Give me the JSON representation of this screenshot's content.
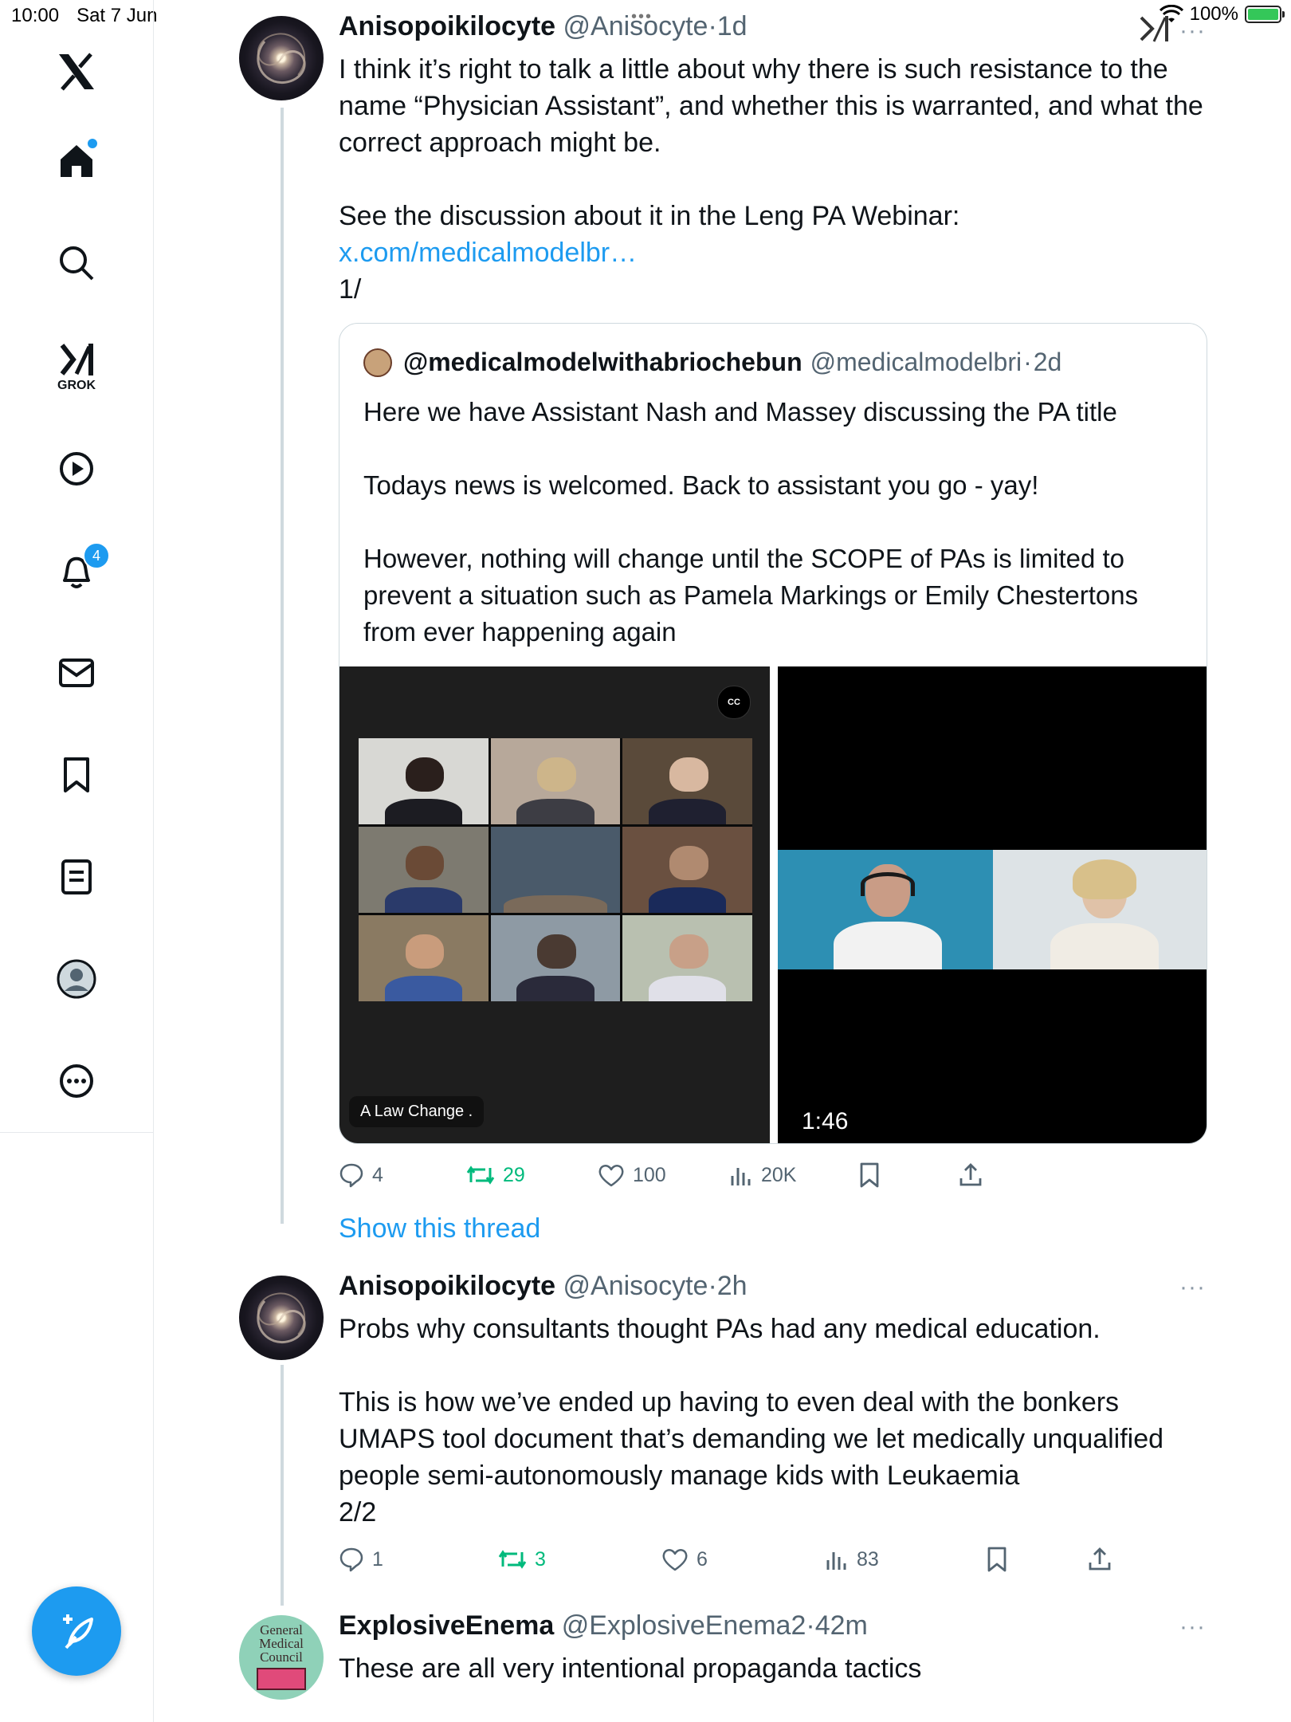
{
  "status_bar": {
    "time": "10:00",
    "date": "Sat 7 Jun",
    "battery": "100%"
  },
  "sidebar": {
    "notification_count": "4",
    "grok_label": "GROK"
  },
  "tweets": [
    {
      "name": "Anisopoikilocyte",
      "handle": "@Anisocyte",
      "time": "1d",
      "text_lines": [
        "I think it’s right to talk a little about why there is such resistance to the name “Physician Assistant”, and whether this is warranted, and what the correct approach might be."
      ],
      "text2": "See the discussion about it in the Leng PA Webinar:",
      "link": "x.com/medicalmodelbr…",
      "numbering": "1/",
      "quote": {
        "name": "@medicalmodelwithabriochebun",
        "handle": "@medicalmodelbri",
        "time": "2d",
        "p1": "Here we have Assistant Nash and Massey discussing the PA title",
        "p2": "Todays news is welcomed. Back to assistant you go - yay!",
        "p3": "However, nothing will change until the SCOPE of PAs is limited to prevent a situation such as Pamela Markings or Emily Chestertons from ever happening again",
        "media_left_caption": "A Law Change .",
        "media_left_cc": "CC",
        "media_right_duration": "1:46"
      },
      "replies": "4",
      "reposts": "29",
      "likes": "100",
      "views": "20K"
    },
    {
      "name": "Anisopoikilocyte",
      "handle": "@Anisocyte",
      "time": "2h",
      "p1": "Probs why consultants thought PAs had any medical education.",
      "p2": "This is how we’ve ended up having to even deal with the bonkers UMAPS tool document that’s demanding we let medically unqualified people semi-autonomously manage kids with Leukaemia",
      "p3": "2/2",
      "replies": "1",
      "reposts": "3",
      "likes": "6",
      "views": "83"
    },
    {
      "name": "ExplosiveEnema",
      "handle": "@ExplosiveEnema2",
      "time": "42m",
      "p1": "These are all very intentional propaganda tactics",
      "avatar_text": "General Medical Council"
    }
  ],
  "show_thread": "Show this thread",
  "colors": {
    "accent": "#1d9bf0",
    "repost_green": "#00ba7c",
    "text_secondary": "#536471"
  }
}
